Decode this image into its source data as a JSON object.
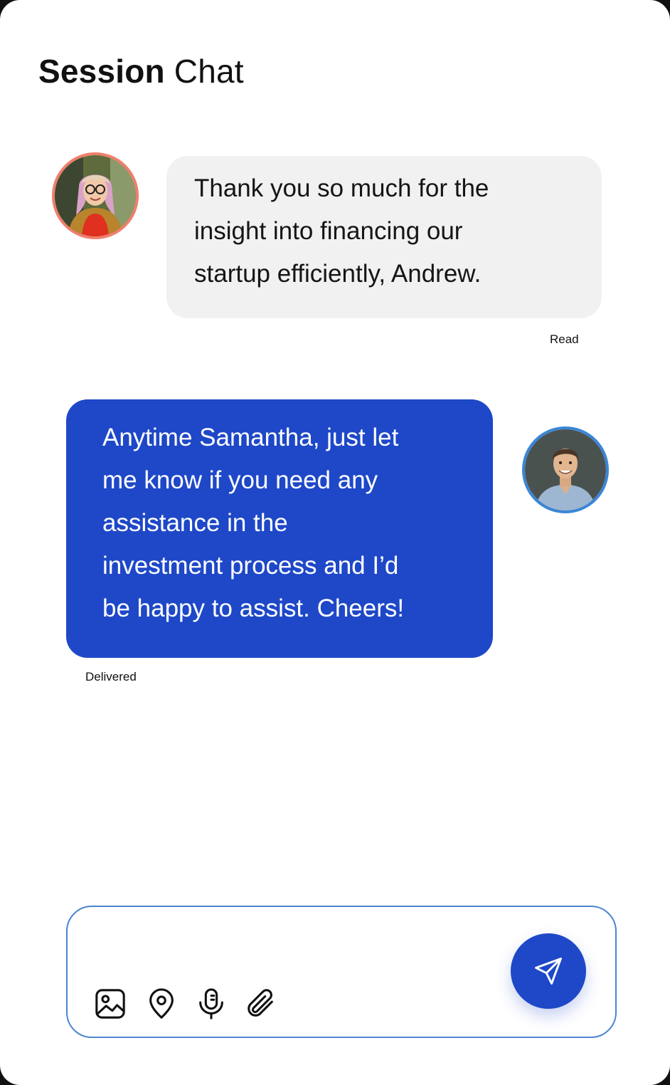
{
  "header": {
    "title_bold": "Session",
    "title_regular": "Chat"
  },
  "messages": [
    {
      "sender": "Samantha",
      "direction": "incoming",
      "avatar_icon": "avatar-samantha",
      "lines": [
        "Thank you so much for the",
        "insight into financing our",
        "startup efficiently, Andrew."
      ],
      "status": "Read"
    },
    {
      "sender": "Andrew",
      "direction": "outgoing",
      "avatar_icon": "avatar-andrew",
      "lines": [
        "Anytime Samantha, just let",
        "me know if you need any",
        "assistance in the",
        "investment process and I’d",
        "be happy to assist. Cheers!"
      ],
      "status": "Delivered"
    }
  ],
  "composer": {
    "value": "",
    "placeholder": "",
    "tools": [
      "image-icon",
      "location-pin-icon",
      "microphone-icon",
      "paperclip-icon"
    ],
    "send_icon": "send-icon"
  },
  "colors": {
    "accent": "#1e48c8",
    "incoming_bubble": "#f1f1f2",
    "composer_border": "#4b86d1",
    "samantha_ring": "#ef7f6b",
    "andrew_ring": "#3a86d6"
  }
}
